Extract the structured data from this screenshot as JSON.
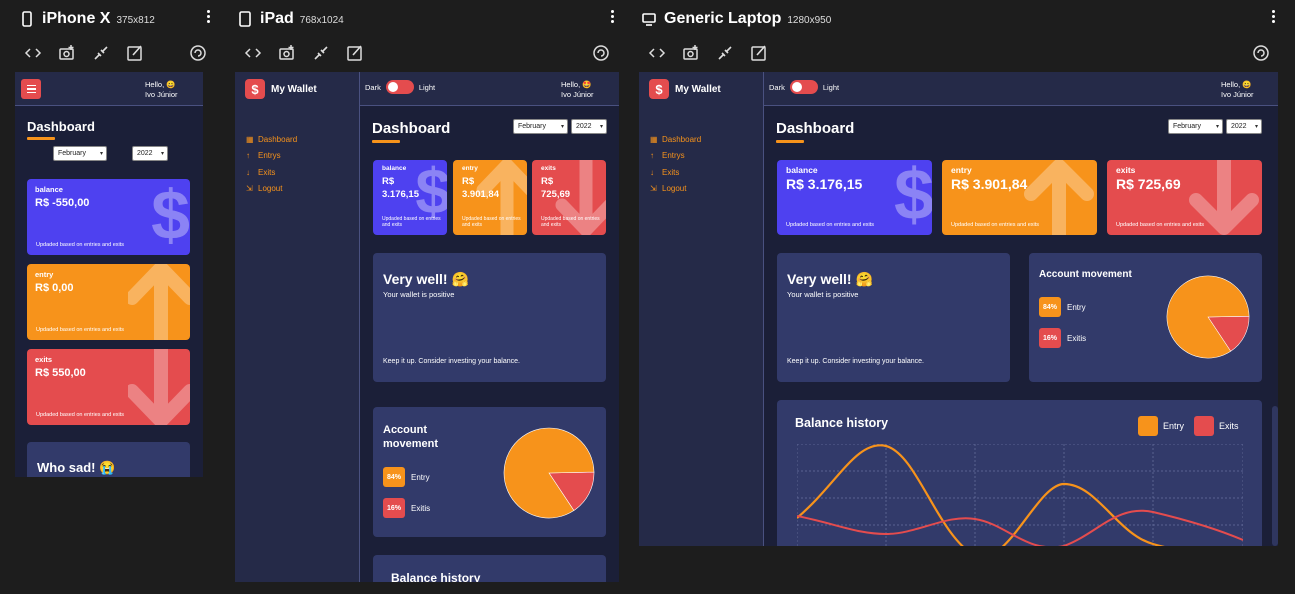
{
  "devices": [
    {
      "name": "iPhone X",
      "size": "375x812",
      "icon": "phone-icon"
    },
    {
      "name": "iPad",
      "size": "768x1024",
      "icon": "tablet-icon"
    },
    {
      "name": "Generic Laptop",
      "size": "1280x950",
      "icon": "laptop-icon"
    }
  ],
  "toolbar_icons": [
    "code-icon",
    "screenshot-icon",
    "link-icon",
    "edit-icon"
  ],
  "app": {
    "brand": "My Wallet",
    "logo_symbol": "$",
    "menu": [
      {
        "label": "Dashboard",
        "icon": "grid-icon"
      },
      {
        "label": "Entrys",
        "icon": "arrow-up-icon"
      },
      {
        "label": "Exits",
        "icon": "arrow-down-icon"
      },
      {
        "label": "Logout",
        "icon": "logout-icon"
      }
    ],
    "theme": {
      "dark": "Dark",
      "light": "Light"
    },
    "hello": "Hello, 😀",
    "hello_tablet": "Hello, 🤩",
    "hello_laptop": "Hello, 😀",
    "user": "Ivo Júnior",
    "title": "Dashboard",
    "month": "February",
    "year": "2022",
    "cards": {
      "balance_label": "balance",
      "entry_label": "entry",
      "exits_label": "exits",
      "footnote": "Updaded based on entries and exits"
    },
    "phone_values": {
      "balance": "R$ -550,00",
      "entry": "R$ 0,00",
      "exits": "R$ 550,00"
    },
    "values": {
      "balance": "R$ 3.176,15",
      "entry": "R$ 3.901,84",
      "exits": "R$ 725,69"
    },
    "values_split": {
      "balance_a": "R$",
      "balance_b": "3.176,15",
      "entry_a": "R$",
      "entry_b": "3.901,84",
      "exits_a": "R$",
      "exits_b": "725,69"
    },
    "phone_message_title": "Who sad! 😭",
    "message": {
      "title": "Very well! 🤗",
      "subtitle": "Your wallet is positive",
      "footer": "Keep it up. Consider investing your balance."
    },
    "account": {
      "title": "Account movement",
      "title_l1": "Account",
      "title_l2": "movement",
      "entry_pct": "84%",
      "entry_label": "Entry",
      "exit_pct": "16%",
      "exit_label": "Exitis"
    },
    "history": {
      "title": "Balance history",
      "legend_entry": "Entry",
      "legend_exits": "Exits"
    }
  },
  "chart_data": {
    "type": "pie",
    "title": "Account movement",
    "categories": [
      "Entry",
      "Exitis"
    ],
    "values": [
      84,
      16
    ],
    "colors": [
      "#f7931b",
      "#e44c4e"
    ]
  }
}
